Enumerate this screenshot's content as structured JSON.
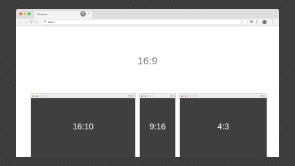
{
  "browser": {
    "traffic_lights": {
      "close": "#ee5e57",
      "minimize": "#f5bd2e",
      "maximize": "#33c748"
    },
    "tab": {
      "title": "Browser",
      "close_glyph": "×"
    },
    "new_tab_glyph": "+",
    "nav": {
      "back": "←",
      "forward": "→",
      "reload": "↻",
      "home": "⌂"
    },
    "address_bar": {
      "url": "http://"
    },
    "toolbar_icons": [
      "star-icon",
      "puzzle-icon",
      "side-panel-icon",
      "profile-icon",
      "menu-icon"
    ],
    "toolbar_glyphs": {
      "star": "☆",
      "puzzle": "✱",
      "sidepanel": "▯",
      "menu": "⋮"
    }
  },
  "content": {
    "main_label": "16:9",
    "previews": [
      {
        "label": "16:10"
      },
      {
        "label": "9:16"
      },
      {
        "label": "4:3"
      }
    ]
  }
}
